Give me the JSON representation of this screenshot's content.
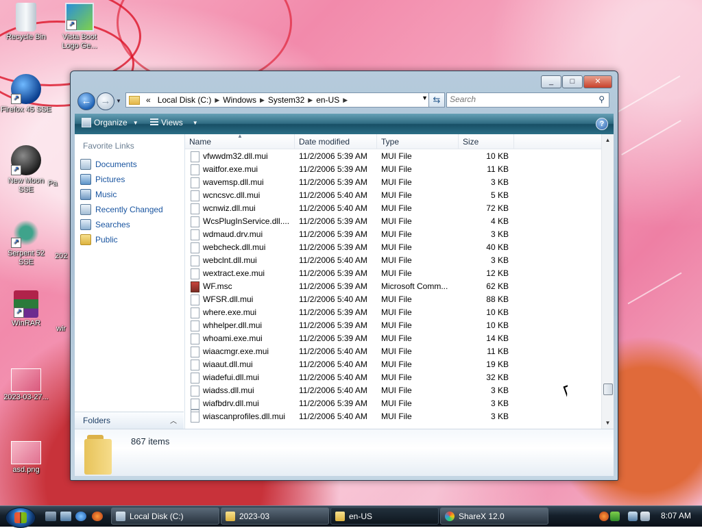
{
  "desktop": {
    "icons": [
      {
        "label": "Recycle Bin"
      },
      {
        "label": "Vista Boot Logo Ge..."
      },
      {
        "label": "Firefox 45 SSE"
      },
      {
        "label": "New Moon SSE"
      },
      {
        "label": "Serpent 52 SSE"
      },
      {
        "label": "WinRAR"
      },
      {
        "label": "2023-03-27..."
      },
      {
        "label": "asd.png"
      },
      {
        "label": "Pa"
      },
      {
        "label": "202"
      },
      {
        "label": "wir"
      }
    ]
  },
  "window": {
    "address": {
      "chevron": "«",
      "crumbs": [
        "Local Disk (C:)",
        "Windows",
        "System32",
        "en-US"
      ]
    },
    "search": {
      "placeholder": "Search"
    },
    "toolbar": {
      "organize": "Organize",
      "views": "Views",
      "help": "?"
    },
    "navpane": {
      "title": "Favorite Links",
      "links": [
        "Documents",
        "Pictures",
        "Music",
        "Recently Changed",
        "Searches",
        "Public"
      ],
      "folders": "Folders"
    },
    "columns": {
      "name": "Name",
      "date": "Date modified",
      "type": "Type",
      "size": "Size"
    },
    "files": [
      {
        "name": "vfwwdm32.dll.mui",
        "date": "11/2/2006 5:39 AM",
        "type": "MUI File",
        "size": "10 KB"
      },
      {
        "name": "waitfor.exe.mui",
        "date": "11/2/2006 5:39 AM",
        "type": "MUI File",
        "size": "11 KB"
      },
      {
        "name": "wavemsp.dll.mui",
        "date": "11/2/2006 5:39 AM",
        "type": "MUI File",
        "size": "3 KB"
      },
      {
        "name": "wcncsvc.dll.mui",
        "date": "11/2/2006 5:40 AM",
        "type": "MUI File",
        "size": "5 KB"
      },
      {
        "name": "wcnwiz.dll.mui",
        "date": "11/2/2006 5:40 AM",
        "type": "MUI File",
        "size": "72 KB"
      },
      {
        "name": "WcsPlugInService.dll....",
        "date": "11/2/2006 5:39 AM",
        "type": "MUI File",
        "size": "4 KB"
      },
      {
        "name": "wdmaud.drv.mui",
        "date": "11/2/2006 5:39 AM",
        "type": "MUI File",
        "size": "3 KB"
      },
      {
        "name": "webcheck.dll.mui",
        "date": "11/2/2006 5:39 AM",
        "type": "MUI File",
        "size": "40 KB"
      },
      {
        "name": "webclnt.dll.mui",
        "date": "11/2/2006 5:40 AM",
        "type": "MUI File",
        "size": "3 KB"
      },
      {
        "name": "wextract.exe.mui",
        "date": "11/2/2006 5:39 AM",
        "type": "MUI File",
        "size": "12 KB"
      },
      {
        "name": "WF.msc",
        "date": "11/2/2006 5:39 AM",
        "type": "Microsoft Comm...",
        "size": "62 KB",
        "icon": "msc"
      },
      {
        "name": "WFSR.dll.mui",
        "date": "11/2/2006 5:40 AM",
        "type": "MUI File",
        "size": "88 KB"
      },
      {
        "name": "where.exe.mui",
        "date": "11/2/2006 5:39 AM",
        "type": "MUI File",
        "size": "10 KB"
      },
      {
        "name": "whhelper.dll.mui",
        "date": "11/2/2006 5:39 AM",
        "type": "MUI File",
        "size": "10 KB"
      },
      {
        "name": "whoami.exe.mui",
        "date": "11/2/2006 5:39 AM",
        "type": "MUI File",
        "size": "14 KB"
      },
      {
        "name": "wiaacmgr.exe.mui",
        "date": "11/2/2006 5:40 AM",
        "type": "MUI File",
        "size": "11 KB"
      },
      {
        "name": "wiaaut.dll.mui",
        "date": "11/2/2006 5:40 AM",
        "type": "MUI File",
        "size": "19 KB"
      },
      {
        "name": "wiadefui.dll.mui",
        "date": "11/2/2006 5:40 AM",
        "type": "MUI File",
        "size": "32 KB"
      },
      {
        "name": "wiadss.dll.mui",
        "date": "11/2/2006 5:40 AM",
        "type": "MUI File",
        "size": "3 KB"
      },
      {
        "name": "wiafbdrv.dll.mui",
        "date": "11/2/2006 5:39 AM",
        "type": "MUI File",
        "size": "3 KB"
      },
      {
        "name": "wiascanprofiles.dll.mui",
        "date": "11/2/2006 5:40 AM",
        "type": "MUI File",
        "size": "3 KB"
      }
    ],
    "details": {
      "count": "867 items"
    }
  },
  "taskbar": {
    "tasks": [
      "Local Disk (C:)",
      "2023-03",
      "en-US",
      "ShareX 12.0"
    ],
    "clock": "8:07 AM"
  }
}
